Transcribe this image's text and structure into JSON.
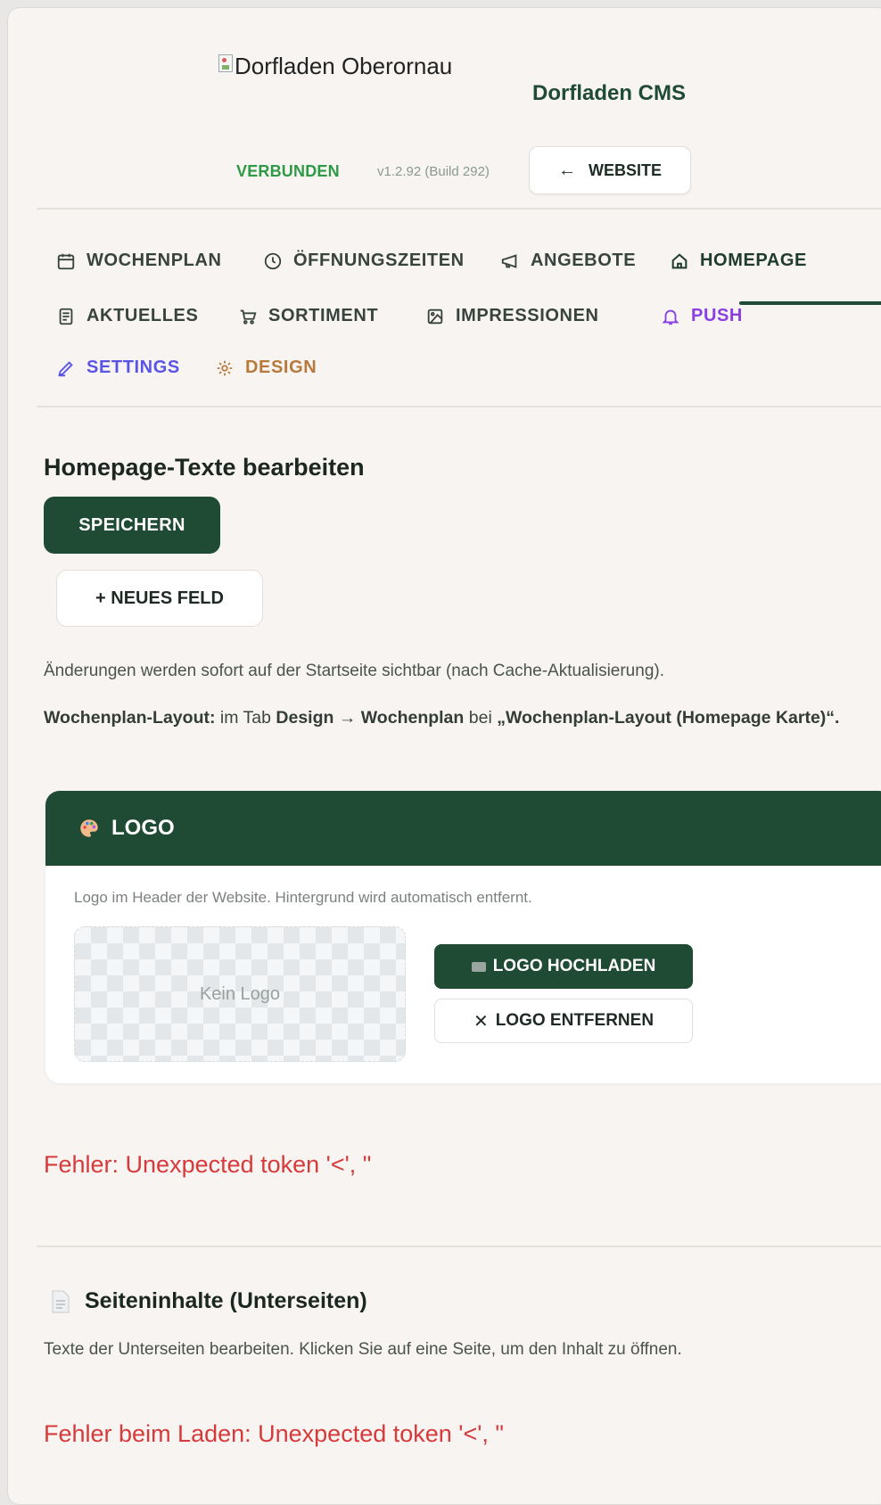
{
  "header": {
    "logo_alt": "Dorfladen Oberornau",
    "cms_title": "Dorfladen CMS",
    "status": "VERBUNDEN",
    "version": "v1.2.92 (Build 292)",
    "website_button": "WEBSITE"
  },
  "tabs": [
    {
      "label": "WOCHENPLAN",
      "icon": "calendar-icon"
    },
    {
      "label": "ÖFFNUNGSZEITEN",
      "icon": "clock-icon"
    },
    {
      "label": "ANGEBOTE",
      "icon": "megaphone-icon"
    },
    {
      "label": "HOMEPAGE",
      "icon": "home-icon",
      "active": true
    },
    {
      "label": "AKTUELLES",
      "icon": "newspaper-icon"
    },
    {
      "label": "SORTIMENT",
      "icon": "cart-icon"
    },
    {
      "label": "IMPRESSIONEN",
      "icon": "image-icon"
    },
    {
      "label": "PUSH",
      "icon": "bell-icon"
    },
    {
      "label": "SETTINGS",
      "icon": "pencil-icon"
    },
    {
      "label": "DESIGN",
      "icon": "gear-icon"
    }
  ],
  "main": {
    "title": "Homepage-Texte bearbeiten",
    "save_button": "SPEICHERN",
    "new_field_button": "+ NEUES FELD",
    "info_line": "Änderungen werden sofort auf der Startseite sichtbar (nach Cache-Aktualisierung).",
    "info2": {
      "label": "Wochenplan-Layout:",
      "text1": "im Tab",
      "design": "Design → Wochenplan",
      "text2": "bei",
      "quote": "„Wochenplan-Layout (Homepage Karte)“."
    }
  },
  "logo_card": {
    "title": "LOGO",
    "description": "Logo im Header der Website. Hintergrund wird automatisch entfernt.",
    "placeholder": "Kein Logo",
    "upload_button": "LOGO HOCHLADEN",
    "remove_button": "LOGO ENTFERNEN"
  },
  "errors": {
    "homepage": "Fehler: Unexpected token '<', \"",
    "subpages": "Fehler beim Laden: Unexpected token '<', \""
  },
  "subpages": {
    "title": "Seiteninhalte (Unterseiten)",
    "description": "Texte der Unterseiten bearbeiten. Klicken Sie auf eine Seite, um den Inhalt zu öffnen."
  },
  "colors": {
    "brand_green": "#1f4a34",
    "connected_green": "#2e9a45",
    "error_red": "#d63a3a",
    "push_purple": "#8a3fe0",
    "settings_indigo": "#5b55e6",
    "design_tan": "#b77a3c"
  }
}
